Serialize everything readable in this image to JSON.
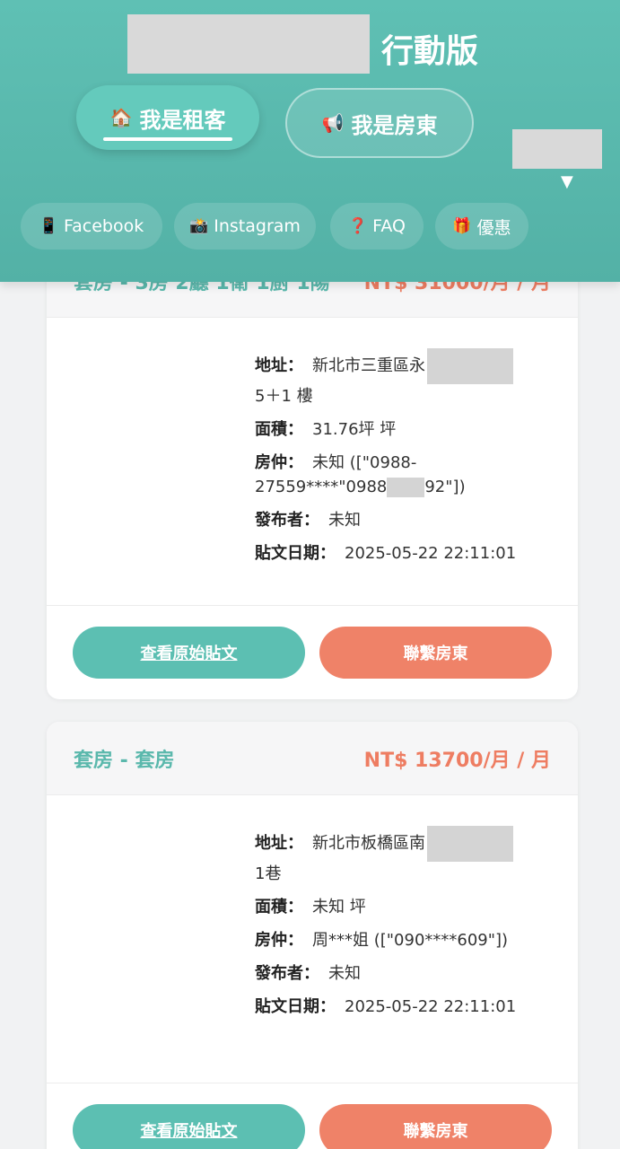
{
  "header": {
    "title_suffix": "行動版",
    "tabs": [
      {
        "icon": "🏠",
        "label": "我是租客",
        "active": true
      },
      {
        "icon": "📢",
        "label": "我是房東",
        "active": false
      }
    ],
    "user_menu_caret": "▼",
    "links": [
      {
        "icon": "📱",
        "label": "Facebook"
      },
      {
        "icon": "📸",
        "label": "Instagram"
      },
      {
        "icon": "❓",
        "label": "FAQ"
      },
      {
        "icon": "🎁",
        "label": "優惠"
      }
    ]
  },
  "listings": [
    {
      "type": "套房 - 3房 2廳 1衛 1廚 1陽",
      "price": "NT$ 31000/月 / 月",
      "address_label": "地址：",
      "address_part1": "新北市三重區永",
      "address_part2": "5＋1 樓",
      "area_label": "面積：",
      "area": "31.76坪 坪",
      "agent_label": "房仲：",
      "agent_part1": "未知 ([\"0988-",
      "agent_part2a": "27559****\"0988",
      "agent_part2b": "92\"])",
      "publisher_label": "發布者：",
      "publisher": "未知",
      "date_label": "貼文日期：",
      "date": "2025-05-22 22:11:01",
      "view_button": "查看原始貼文",
      "contact_button": "聯繫房東"
    },
    {
      "type": "套房 - 套房",
      "price": "NT$ 13700/月 / 月",
      "address_label": "地址：",
      "address_part1": "新北市板橋區南",
      "address_part2": "1巷",
      "area_label": "面積：",
      "area": "未知 坪",
      "agent_label": "房仲：",
      "agent": "周***姐 ([\"090****609\"])",
      "publisher_label": "發布者：",
      "publisher": "未知",
      "date_label": "貼文日期：",
      "date": "2025-05-22 22:11:01",
      "view_button": "查看原始貼文",
      "contact_button": "聯繫房東"
    }
  ]
}
